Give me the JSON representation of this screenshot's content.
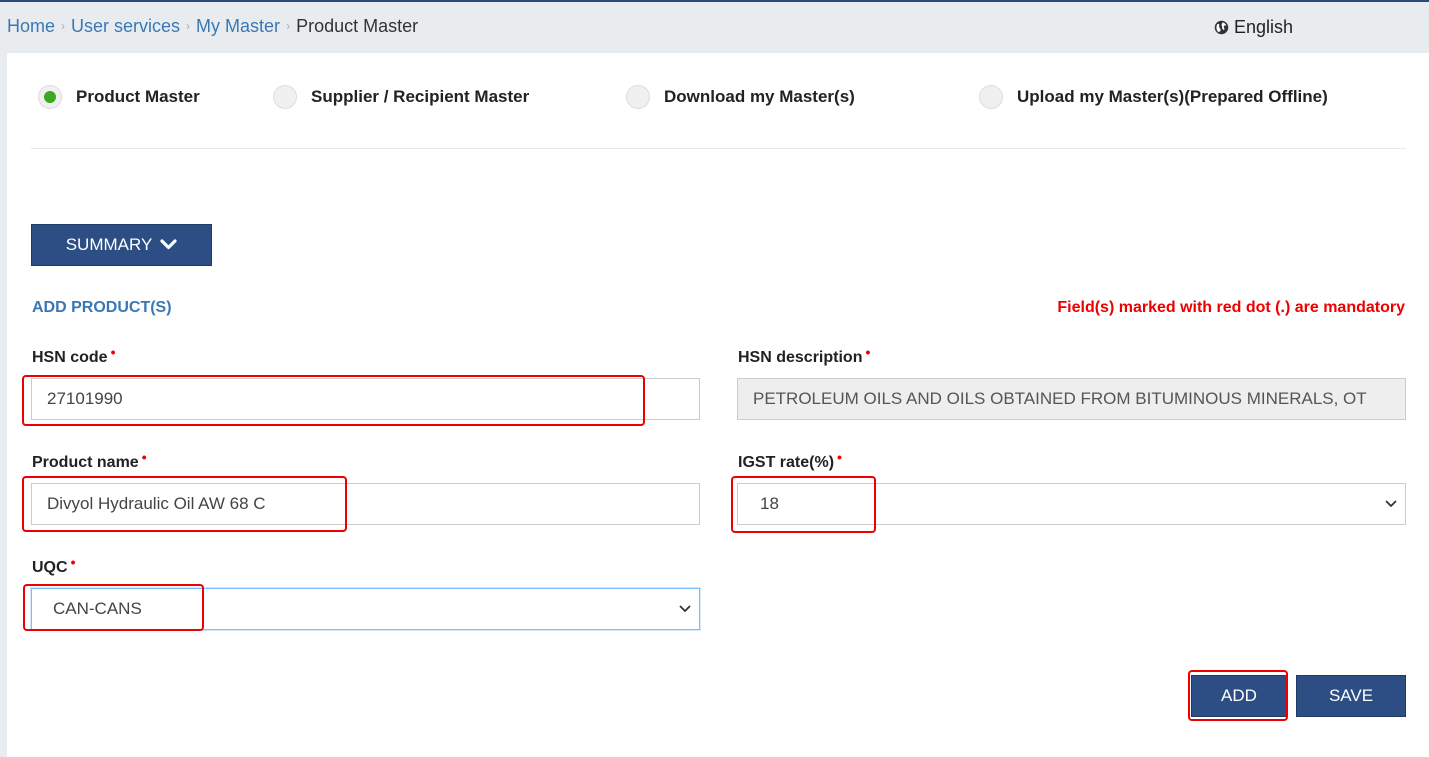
{
  "breadcrumb": {
    "home": "Home",
    "user_services": "User services",
    "my_master": "My Master",
    "current": "Product Master"
  },
  "language": {
    "label": "English",
    "icon": "globe-icon"
  },
  "master_options": [
    {
      "label": "Product Master",
      "checked": true
    },
    {
      "label": "Supplier / Recipient Master",
      "checked": false
    },
    {
      "label": "Download my Master(s)",
      "checked": false
    },
    {
      "label": "Upload my Master(s)(Prepared Offline)",
      "checked": false
    }
  ],
  "summary_button": {
    "label": "SUMMARY",
    "icon": "chevron-down-icon"
  },
  "section_title": "ADD PRODUCT(S)",
  "mandatory_note": "Field(s) marked with red dot (.) are mandatory",
  "fields": {
    "hsn_code": {
      "label": "HSN code",
      "value": "27101990"
    },
    "hsn_description": {
      "label": "HSN description",
      "value": "PETROLEUM OILS AND OILS OBTAINED FROM  BITUMINOUS MINERALS, OT"
    },
    "product_name": {
      "label": "Product name",
      "value": "Divyol Hydraulic Oil AW 68 C"
    },
    "igst_rate": {
      "label": "IGST rate(%)",
      "value": "18"
    },
    "uqc": {
      "label": "UQC",
      "value": "CAN-CANS"
    }
  },
  "required_marker": "•",
  "buttons": {
    "add": "ADD",
    "save": "SAVE"
  },
  "colors": {
    "primary": "#2c4e85",
    "link": "#3a78b5",
    "mandatory": "#e00000",
    "radio_checked": "#3ca81f",
    "highlight": "#e00000"
  }
}
